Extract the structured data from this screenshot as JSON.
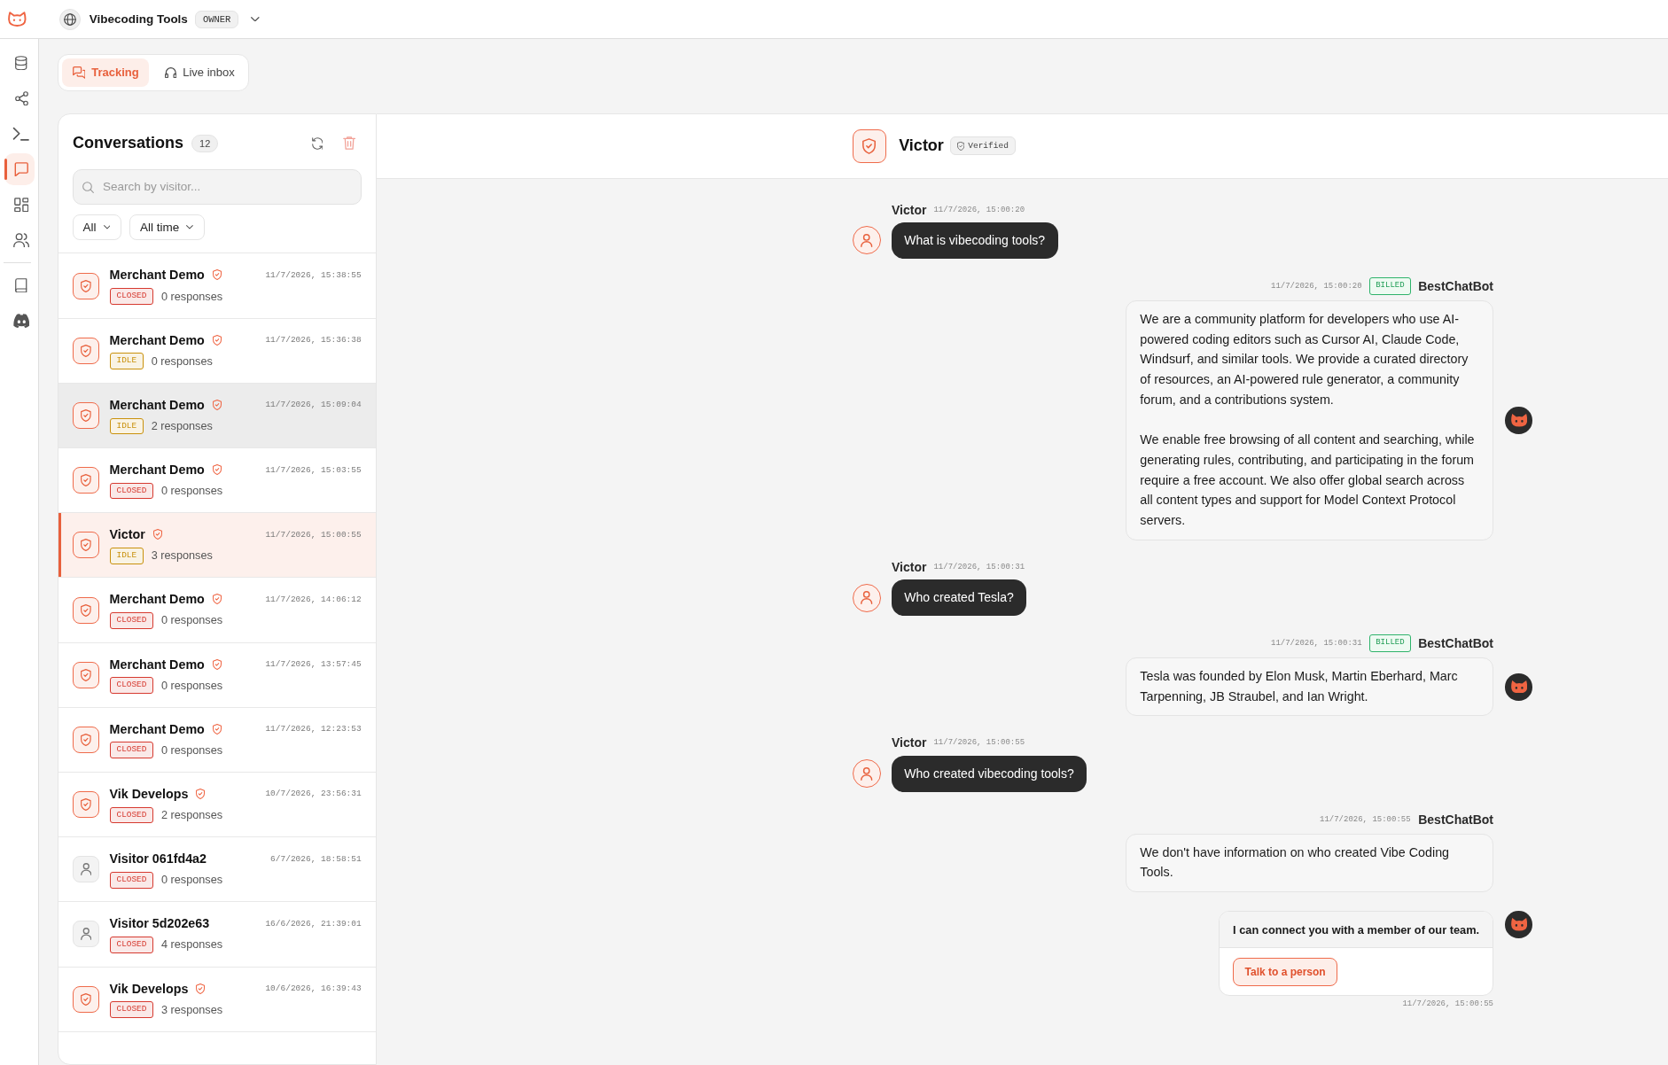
{
  "top_bar": {
    "workspace": "Vibecoding Tools",
    "role": "OWNER"
  },
  "rail": {
    "groups": [
      {
        "items": [
          {
            "kind": "database",
            "selected": false
          },
          {
            "kind": "share",
            "selected": false
          },
          {
            "kind": "terminal",
            "selected": false
          },
          {
            "kind": "chat",
            "selected": true
          },
          {
            "kind": "grid",
            "selected": false
          },
          {
            "kind": "users",
            "selected": false
          }
        ]
      },
      {
        "items": [
          {
            "kind": "book",
            "selected": false
          },
          {
            "kind": "controller",
            "selected": false
          }
        ]
      }
    ]
  },
  "tabs": [
    {
      "label": "Tracking",
      "kind": "chats",
      "selected": true
    },
    {
      "label": "Live inbox",
      "kind": "headset",
      "selected": false
    }
  ],
  "conversations": {
    "title": "Conversations",
    "count": "12",
    "search": {
      "placeholder": "Search by visitor..."
    },
    "filters": [
      {
        "label": "All"
      },
      {
        "label": "All time"
      }
    ],
    "items": [
      {
        "name": "Merchant Demo",
        "verified": true,
        "status": {
          "label": "CLOSED",
          "color": "#d63a30"
        },
        "responses": "0 responses",
        "time": "11/7/2026, 15:38:55",
        "selected": false,
        "hovered": false
      },
      {
        "name": "Merchant Demo",
        "verified": true,
        "status": {
          "label": "IDLE",
          "color": "#c9910c"
        },
        "responses": "0 responses",
        "time": "11/7/2026, 15:36:38",
        "selected": false,
        "hovered": false
      },
      {
        "name": "Merchant Demo",
        "verified": true,
        "status": {
          "label": "IDLE",
          "color": "#c9910c"
        },
        "responses": "2 responses",
        "time": "11/7/2026, 15:09:04",
        "selected": false,
        "hovered": true
      },
      {
        "name": "Merchant Demo",
        "verified": true,
        "status": {
          "label": "CLOSED",
          "color": "#d63a30"
        },
        "responses": "0 responses",
        "time": "11/7/2026, 15:03:55",
        "selected": false,
        "hovered": false
      },
      {
        "name": "Victor",
        "verified": true,
        "status": {
          "label": "IDLE",
          "color": "#c9910c"
        },
        "responses": "3 responses",
        "time": "11/7/2026, 15:00:55",
        "selected": true,
        "hovered": false
      },
      {
        "name": "Merchant Demo",
        "verified": true,
        "status": {
          "label": "CLOSED",
          "color": "#d63a30"
        },
        "responses": "0 responses",
        "time": "11/7/2026, 14:06:12",
        "selected": false,
        "hovered": false
      },
      {
        "name": "Merchant Demo",
        "verified": true,
        "status": {
          "label": "CLOSED",
          "color": "#d63a30"
        },
        "responses": "0 responses",
        "time": "11/7/2026, 13:57:45",
        "selected": false,
        "hovered": false
      },
      {
        "name": "Merchant Demo",
        "verified": true,
        "status": {
          "label": "CLOSED",
          "color": "#d63a30"
        },
        "responses": "0 responses",
        "time": "11/7/2026, 12:23:53",
        "selected": false,
        "hovered": false
      },
      {
        "name": "Vik Develops",
        "verified": true,
        "status": {
          "label": "CLOSED",
          "color": "#d63a30"
        },
        "responses": "2 responses",
        "time": "10/7/2026, 23:56:31",
        "selected": false,
        "hovered": false
      },
      {
        "name": "Visitor 061fd4a2",
        "verified": false,
        "status": {
          "label": "CLOSED",
          "color": "#d63a30"
        },
        "responses": "0 responses",
        "time": "6/7/2026, 18:58:51",
        "selected": false,
        "hovered": false
      },
      {
        "name": "Visitor 5d202e63",
        "verified": false,
        "status": {
          "label": "CLOSED",
          "color": "#d63a30"
        },
        "responses": "4 responses",
        "time": "16/6/2026, 21:39:01",
        "selected": false,
        "hovered": false
      },
      {
        "name": "Vik Develops",
        "verified": true,
        "status": {
          "label": "CLOSED",
          "color": "#d63a30"
        },
        "responses": "3 responses",
        "time": "10/6/2026, 16:39:43",
        "selected": false,
        "hovered": false
      }
    ]
  },
  "chat": {
    "header": {
      "name": "Victor",
      "verified": true,
      "badge": "Verified"
    },
    "messages": [
      {
        "kind": "user",
        "author": "Victor",
        "time": "11/7/2026, 15:00:20",
        "text": "What is vibecoding tools?"
      },
      {
        "kind": "bot",
        "author": "BestChatBot",
        "time": "11/7/2026, 15:00:20",
        "badge": "BILLED",
        "avatar": true,
        "paragraphs": [
          "We are a community platform for developers who use AI-powered coding editors such as Cursor AI, Claude Code, Windsurf, and similar tools. We provide a curated directory of resources, an AI-powered rule generator, a community forum, and a contributions system.",
          "We enable free browsing of all content and searching, while generating rules, contributing, and participating in the forum require a free account. We also offer global search across all content types and support for Model Context Protocol servers."
        ]
      },
      {
        "kind": "user",
        "author": "Victor",
        "time": "11/7/2026, 15:00:31",
        "text": "Who created Tesla?"
      },
      {
        "kind": "bot",
        "author": "BestChatBot",
        "time": "11/7/2026, 15:00:31",
        "badge": "BILLED",
        "avatar": true,
        "paragraphs": [
          "Tesla was founded by Elon Musk, Martin Eberhard, Marc Tarpenning, JB Straubel, and Ian Wright."
        ]
      },
      {
        "kind": "user",
        "author": "Victor",
        "time": "11/7/2026, 15:00:55",
        "text": "Who created vibecoding tools?"
      },
      {
        "kind": "bot",
        "author": "BestChatBot",
        "time": "11/7/2026, 15:00:55",
        "avatar": false,
        "paragraphs": [
          "We don't have information on who created Vibe Coding Tools."
        ]
      },
      {
        "kind": "action",
        "text": "I can connect you with a member of our team.",
        "button": "Talk to a person",
        "time": "11/7/2026, 15:00:55",
        "avatar": true
      }
    ]
  }
}
